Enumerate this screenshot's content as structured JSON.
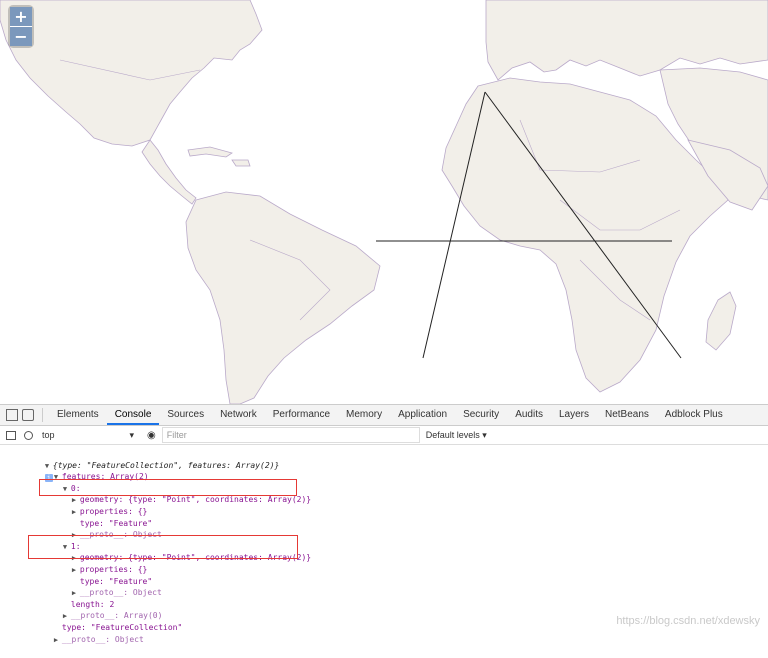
{
  "map": {
    "zoom_in": "+",
    "zoom_out": "−",
    "land_color": "#f2efe9",
    "border_color": "#b9a9c9",
    "line_color": "#222222"
  },
  "devtools": {
    "tabs": [
      "Elements",
      "Console",
      "Sources",
      "Network",
      "Performance",
      "Memory",
      "Application",
      "Security",
      "Audits",
      "Layers",
      "NetBeans",
      "Adblock Plus"
    ],
    "active_tab": "Console",
    "context": "top",
    "filter_placeholder": "Filter",
    "levels": "Default levels ▾"
  },
  "console": {
    "root_summary": "{type: \"FeatureCollection\", features: Array(2)}",
    "features_label": "features: Array(2)",
    "idx0": "0:",
    "idx1": "1:",
    "geometry": "geometry: {type: \"Point\", coordinates: Array(2)}",
    "properties": "properties: {}",
    "type_feature": "type: \"Feature\"",
    "proto_object": "__proto__: Object",
    "length": "length: 2",
    "proto_array": "__proto__: Array(0)",
    "type_fc": "type: \"FeatureCollection\"",
    "proto_root": "__proto__: Object"
  },
  "watermark": "https://blog.csdn.net/xdewsky"
}
